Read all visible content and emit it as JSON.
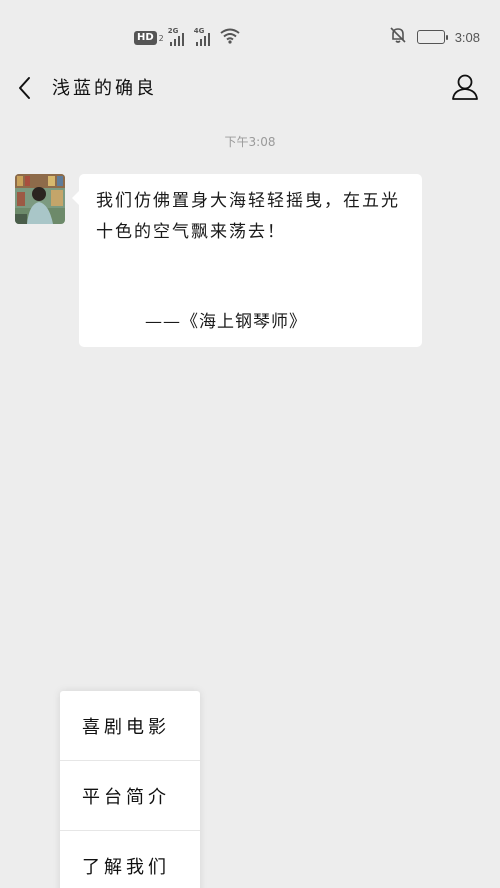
{
  "status_bar": {
    "hd_label": "HD",
    "hd_sub": "2",
    "signal1_label": "2G",
    "signal2_label": "4G",
    "wifi_icon": "wifi-icon",
    "mute_icon": "bell-off-icon",
    "battery_icon": "battery-icon",
    "battery_level": 1.0,
    "time": "3:08"
  },
  "navbar": {
    "back_icon": "chevron-left-icon",
    "title": "浅蓝的确良",
    "profile_icon": "user-icon"
  },
  "chat": {
    "timestamp": "下午3:08",
    "message": {
      "text": "我们仿佛置身大海轻轻摇曳，在五光十色的空气飘来荡去！",
      "attribution": "——《海上钢琴师》"
    }
  },
  "menu": {
    "items": [
      {
        "label": "喜剧电影"
      },
      {
        "label": "平台简介"
      },
      {
        "label": "了解我们"
      }
    ]
  },
  "colors": {
    "background": "#ededed",
    "bubble": "#ffffff",
    "timestamp": "#9a9a9a"
  }
}
